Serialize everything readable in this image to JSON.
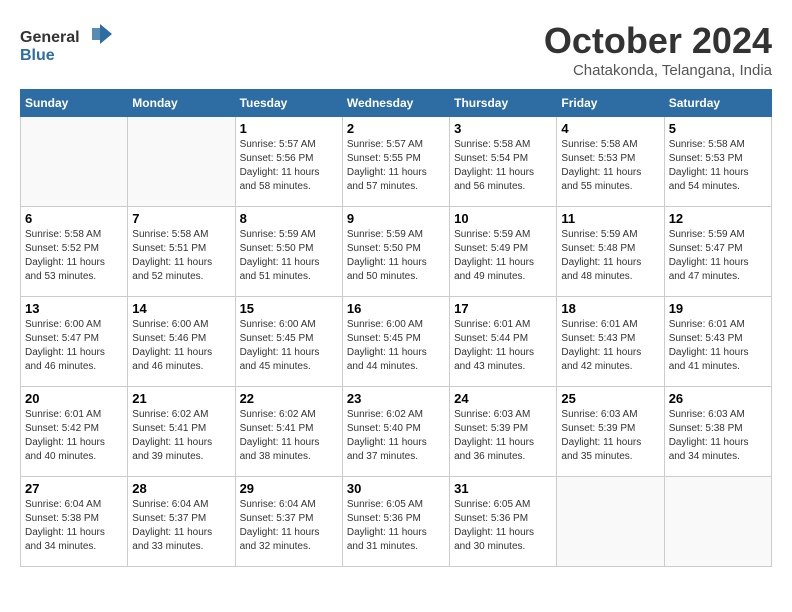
{
  "header": {
    "logo_general": "General",
    "logo_blue": "Blue",
    "title": "October 2024",
    "location": "Chatakonda, Telangana, India"
  },
  "weekdays": [
    "Sunday",
    "Monday",
    "Tuesday",
    "Wednesday",
    "Thursday",
    "Friday",
    "Saturday"
  ],
  "weeks": [
    [
      {
        "day": "",
        "sunrise": "",
        "sunset": "",
        "daylight": ""
      },
      {
        "day": "",
        "sunrise": "",
        "sunset": "",
        "daylight": ""
      },
      {
        "day": "1",
        "sunrise": "Sunrise: 5:57 AM",
        "sunset": "Sunset: 5:56 PM",
        "daylight": "Daylight: 11 hours and 58 minutes."
      },
      {
        "day": "2",
        "sunrise": "Sunrise: 5:57 AM",
        "sunset": "Sunset: 5:55 PM",
        "daylight": "Daylight: 11 hours and 57 minutes."
      },
      {
        "day": "3",
        "sunrise": "Sunrise: 5:58 AM",
        "sunset": "Sunset: 5:54 PM",
        "daylight": "Daylight: 11 hours and 56 minutes."
      },
      {
        "day": "4",
        "sunrise": "Sunrise: 5:58 AM",
        "sunset": "Sunset: 5:53 PM",
        "daylight": "Daylight: 11 hours and 55 minutes."
      },
      {
        "day": "5",
        "sunrise": "Sunrise: 5:58 AM",
        "sunset": "Sunset: 5:53 PM",
        "daylight": "Daylight: 11 hours and 54 minutes."
      }
    ],
    [
      {
        "day": "6",
        "sunrise": "Sunrise: 5:58 AM",
        "sunset": "Sunset: 5:52 PM",
        "daylight": "Daylight: 11 hours and 53 minutes."
      },
      {
        "day": "7",
        "sunrise": "Sunrise: 5:58 AM",
        "sunset": "Sunset: 5:51 PM",
        "daylight": "Daylight: 11 hours and 52 minutes."
      },
      {
        "day": "8",
        "sunrise": "Sunrise: 5:59 AM",
        "sunset": "Sunset: 5:50 PM",
        "daylight": "Daylight: 11 hours and 51 minutes."
      },
      {
        "day": "9",
        "sunrise": "Sunrise: 5:59 AM",
        "sunset": "Sunset: 5:50 PM",
        "daylight": "Daylight: 11 hours and 50 minutes."
      },
      {
        "day": "10",
        "sunrise": "Sunrise: 5:59 AM",
        "sunset": "Sunset: 5:49 PM",
        "daylight": "Daylight: 11 hours and 49 minutes."
      },
      {
        "day": "11",
        "sunrise": "Sunrise: 5:59 AM",
        "sunset": "Sunset: 5:48 PM",
        "daylight": "Daylight: 11 hours and 48 minutes."
      },
      {
        "day": "12",
        "sunrise": "Sunrise: 5:59 AM",
        "sunset": "Sunset: 5:47 PM",
        "daylight": "Daylight: 11 hours and 47 minutes."
      }
    ],
    [
      {
        "day": "13",
        "sunrise": "Sunrise: 6:00 AM",
        "sunset": "Sunset: 5:47 PM",
        "daylight": "Daylight: 11 hours and 46 minutes."
      },
      {
        "day": "14",
        "sunrise": "Sunrise: 6:00 AM",
        "sunset": "Sunset: 5:46 PM",
        "daylight": "Daylight: 11 hours and 46 minutes."
      },
      {
        "day": "15",
        "sunrise": "Sunrise: 6:00 AM",
        "sunset": "Sunset: 5:45 PM",
        "daylight": "Daylight: 11 hours and 45 minutes."
      },
      {
        "day": "16",
        "sunrise": "Sunrise: 6:00 AM",
        "sunset": "Sunset: 5:45 PM",
        "daylight": "Daylight: 11 hours and 44 minutes."
      },
      {
        "day": "17",
        "sunrise": "Sunrise: 6:01 AM",
        "sunset": "Sunset: 5:44 PM",
        "daylight": "Daylight: 11 hours and 43 minutes."
      },
      {
        "day": "18",
        "sunrise": "Sunrise: 6:01 AM",
        "sunset": "Sunset: 5:43 PM",
        "daylight": "Daylight: 11 hours and 42 minutes."
      },
      {
        "day": "19",
        "sunrise": "Sunrise: 6:01 AM",
        "sunset": "Sunset: 5:43 PM",
        "daylight": "Daylight: 11 hours and 41 minutes."
      }
    ],
    [
      {
        "day": "20",
        "sunrise": "Sunrise: 6:01 AM",
        "sunset": "Sunset: 5:42 PM",
        "daylight": "Daylight: 11 hours and 40 minutes."
      },
      {
        "day": "21",
        "sunrise": "Sunrise: 6:02 AM",
        "sunset": "Sunset: 5:41 PM",
        "daylight": "Daylight: 11 hours and 39 minutes."
      },
      {
        "day": "22",
        "sunrise": "Sunrise: 6:02 AM",
        "sunset": "Sunset: 5:41 PM",
        "daylight": "Daylight: 11 hours and 38 minutes."
      },
      {
        "day": "23",
        "sunrise": "Sunrise: 6:02 AM",
        "sunset": "Sunset: 5:40 PM",
        "daylight": "Daylight: 11 hours and 37 minutes."
      },
      {
        "day": "24",
        "sunrise": "Sunrise: 6:03 AM",
        "sunset": "Sunset: 5:39 PM",
        "daylight": "Daylight: 11 hours and 36 minutes."
      },
      {
        "day": "25",
        "sunrise": "Sunrise: 6:03 AM",
        "sunset": "Sunset: 5:39 PM",
        "daylight": "Daylight: 11 hours and 35 minutes."
      },
      {
        "day": "26",
        "sunrise": "Sunrise: 6:03 AM",
        "sunset": "Sunset: 5:38 PM",
        "daylight": "Daylight: 11 hours and 34 minutes."
      }
    ],
    [
      {
        "day": "27",
        "sunrise": "Sunrise: 6:04 AM",
        "sunset": "Sunset: 5:38 PM",
        "daylight": "Daylight: 11 hours and 34 minutes."
      },
      {
        "day": "28",
        "sunrise": "Sunrise: 6:04 AM",
        "sunset": "Sunset: 5:37 PM",
        "daylight": "Daylight: 11 hours and 33 minutes."
      },
      {
        "day": "29",
        "sunrise": "Sunrise: 6:04 AM",
        "sunset": "Sunset: 5:37 PM",
        "daylight": "Daylight: 11 hours and 32 minutes."
      },
      {
        "day": "30",
        "sunrise": "Sunrise: 6:05 AM",
        "sunset": "Sunset: 5:36 PM",
        "daylight": "Daylight: 11 hours and 31 minutes."
      },
      {
        "day": "31",
        "sunrise": "Sunrise: 6:05 AM",
        "sunset": "Sunset: 5:36 PM",
        "daylight": "Daylight: 11 hours and 30 minutes."
      },
      {
        "day": "",
        "sunrise": "",
        "sunset": "",
        "daylight": ""
      },
      {
        "day": "",
        "sunrise": "",
        "sunset": "",
        "daylight": ""
      }
    ]
  ]
}
